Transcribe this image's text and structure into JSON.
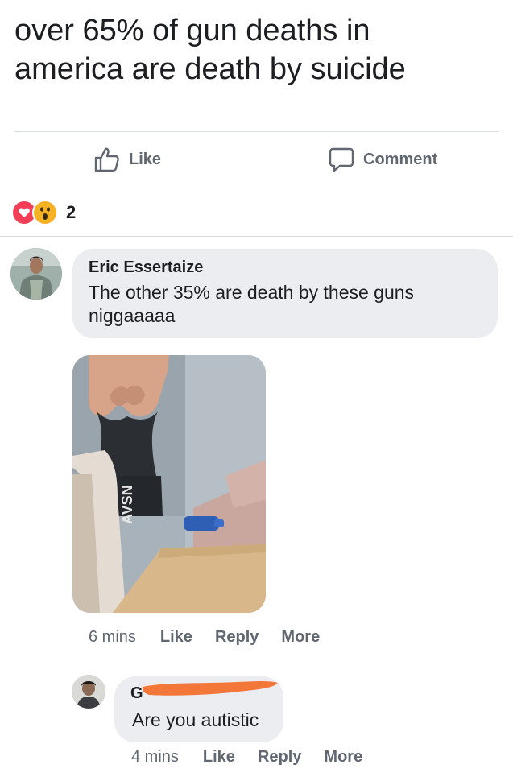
{
  "post": {
    "text_lines": [
      "over 65% of gun deaths in",
      "america are death by suicide"
    ]
  },
  "actions": {
    "like_label": "Like",
    "comment_label": "Comment"
  },
  "reactions": {
    "types": [
      "love",
      "wow"
    ],
    "count": "2"
  },
  "comments": [
    {
      "author": "Eric Essertaize",
      "text_lines": [
        "The other 35% are death by these guns",
        "niggaaaaa"
      ],
      "photo_shirt_text": "AVSN",
      "time": "6 mins",
      "like_label": "Like",
      "reply_label": "Reply",
      "more_label": "More"
    },
    {
      "author_initial": "G",
      "author_redacted": true,
      "text": "Are you autistic",
      "time": "4 mins",
      "like_label": "Like",
      "reply_label": "Reply",
      "more_label": "More"
    }
  ],
  "colors": {
    "bubble": "#ebedf0",
    "secondary_text": "#606770",
    "love": "#f33e58",
    "wow": "#f7b125",
    "redaction": "#f4773a"
  }
}
